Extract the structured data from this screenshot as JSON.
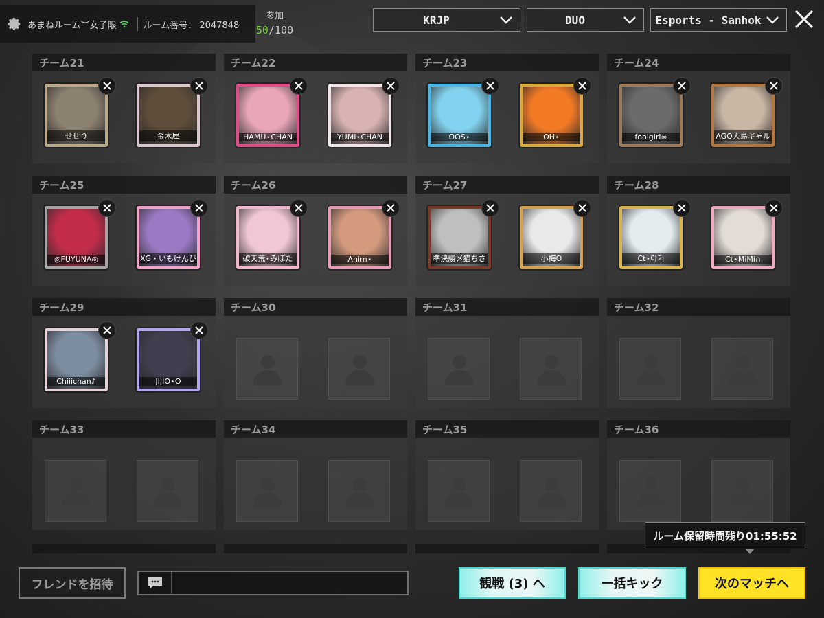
{
  "header": {
    "room_name": "あまねルーム︶女子限",
    "room_number_label": "ルーム番号：",
    "room_number": "2047848",
    "participants_label": "参加",
    "participants_current": "50",
    "participants_max": "/100",
    "participants_color": "#6fcf3a"
  },
  "dropdowns": {
    "region": "KRJP",
    "mode": "DUO",
    "map": "Esports - Sanhok"
  },
  "teams": [
    {
      "label": "チーム21",
      "players": [
        {
          "name": "せせり",
          "frame": "#b9a98a",
          "fill": "#8c8170"
        },
        {
          "name": "金木犀",
          "frame": "#d9c6cf",
          "fill": "#5e4d3a"
        }
      ]
    },
    {
      "label": "チーム22",
      "players": [
        {
          "name": "HAMU⋆CHAN",
          "frame": "#e14d8a",
          "fill": "#e8a6b8"
        },
        {
          "name": "YUMI⋆CHAN",
          "frame": "#f0e6ea",
          "fill": "#d9b3b3"
        }
      ]
    },
    {
      "label": "チーム23",
      "players": [
        {
          "name": "OOS⋆",
          "frame": "#4ab6e6",
          "fill": "#82d3ef"
        },
        {
          "name": "OH⋆",
          "frame": "#d8a93c",
          "fill": "#f27a25"
        }
      ]
    },
    {
      "label": "チーム24",
      "players": [
        {
          "name": "foolgirl∞",
          "frame": "#9a7a5a",
          "fill": "#6b6b6b"
        },
        {
          "name": "AGO大島ギャル",
          "frame": "#b3763e",
          "fill": "#c9b6a4"
        }
      ]
    },
    {
      "label": "チーム25",
      "players": [
        {
          "name": "◎FUYUNA◎",
          "frame": "#a6a6a6",
          "fill": "#c22c4a"
        },
        {
          "name": "XG・いもけんぴ",
          "frame": "#f1a4c8",
          "fill": "#9b7ac4"
        }
      ]
    },
    {
      "label": "チーム26",
      "players": [
        {
          "name": "破天荒⋆みぽた",
          "frame": "#f3b6cf",
          "fill": "#f1c7d6"
        },
        {
          "name": "Anim⋆",
          "frame": "#e79bb6",
          "fill": "#d39a7e"
        }
      ]
    },
    {
      "label": "チーム27",
      "players": [
        {
          "name": "準決勝〆猫ちさ",
          "frame": "#7a3a2a",
          "fill": "#bfbfbf"
        },
        {
          "name": "小梅O",
          "frame": "#d6a24e",
          "fill": "#e9e9e9"
        }
      ]
    },
    {
      "label": "チーム28",
      "players": [
        {
          "name": "Ct⋆아기",
          "frame": "#d9b54e",
          "fill": "#e4ecef"
        },
        {
          "name": "Ct⋆MiMi∩",
          "frame": "#f0a9c2",
          "fill": "#e3dcd6"
        }
      ]
    },
    {
      "label": "チーム29",
      "players": [
        {
          "name": "Chiiichan♪",
          "frame": "#e5d2d8",
          "fill": "#7d8da0"
        },
        {
          "name": "JIJIO⋆O",
          "frame": "#b3a6f0",
          "fill": "#3f3f4f"
        }
      ]
    },
    {
      "label": "チーム30",
      "players": []
    },
    {
      "label": "チーム31",
      "players": []
    },
    {
      "label": "チーム32",
      "players": []
    },
    {
      "label": "チーム33",
      "players": []
    },
    {
      "label": "チーム34",
      "players": []
    },
    {
      "label": "チーム35",
      "players": []
    },
    {
      "label": "チーム36",
      "players": []
    }
  ],
  "footer": {
    "invite_label": "フレンドを招待",
    "chat_placeholder": "",
    "timer_text": "ルーム保留時間残り01:55:52",
    "spectate_label": "観戦 (3) へ",
    "kick_label": "一括キック",
    "next_match_label": "次のマッチへ",
    "accent_cyan": "#4fd8d0",
    "accent_yellow": "#ffe226"
  }
}
